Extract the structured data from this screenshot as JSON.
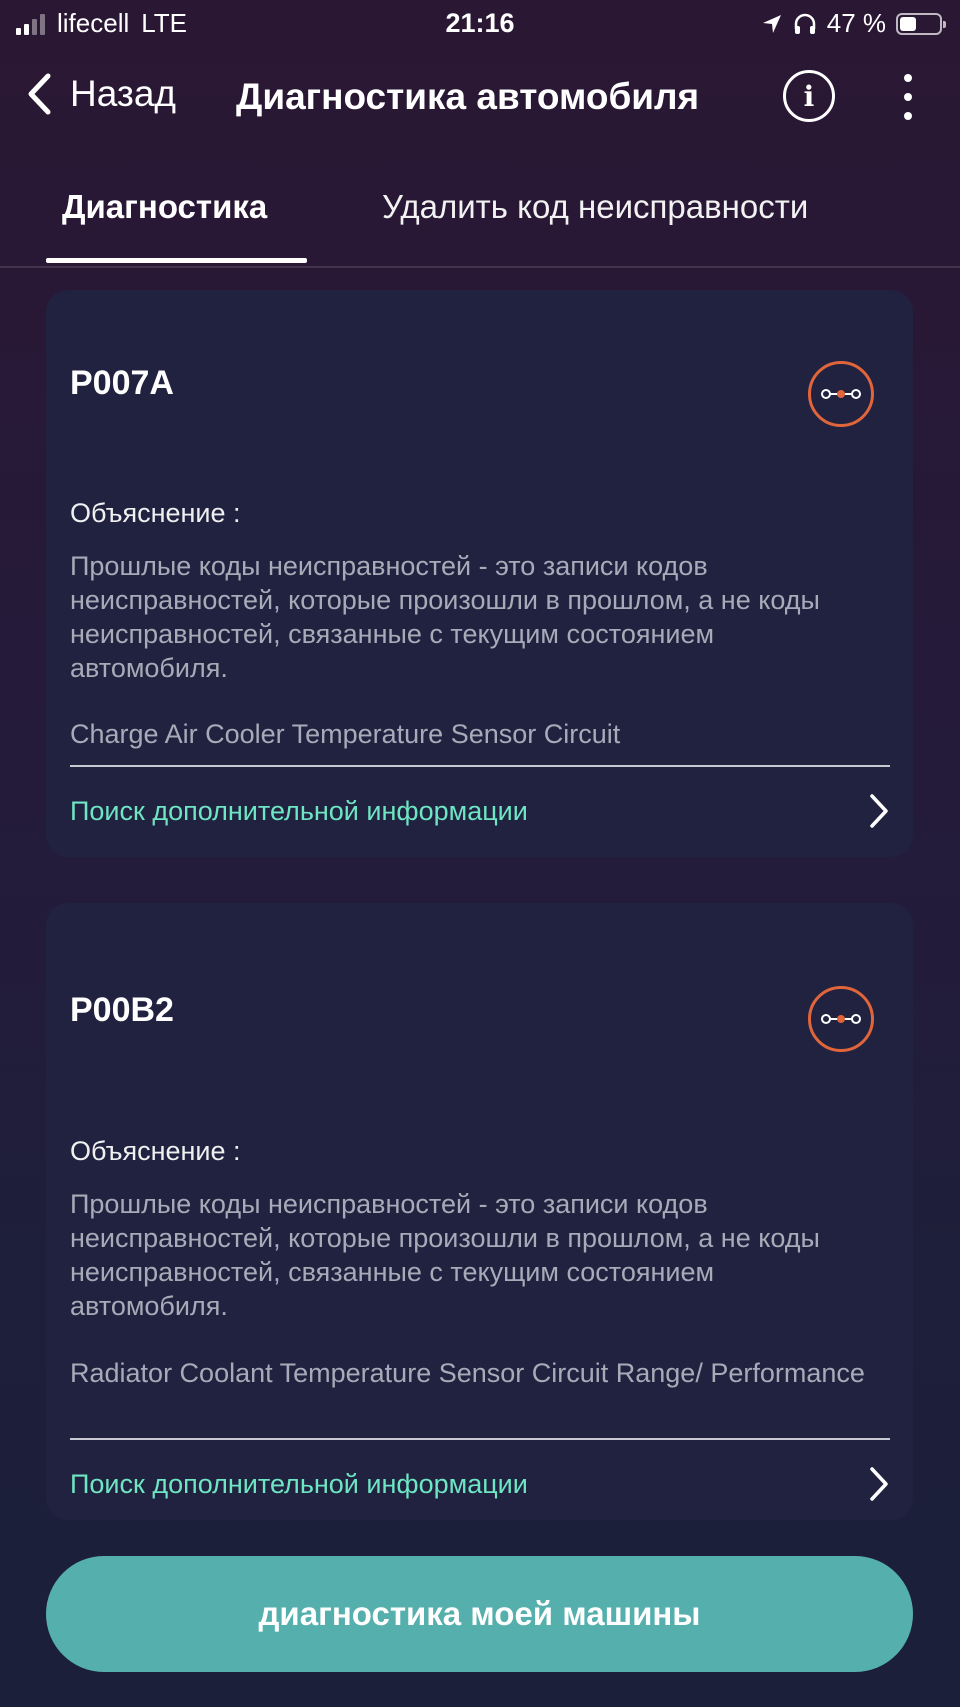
{
  "status_bar": {
    "carrier": "lifecell",
    "network": "LTE",
    "time": "21:16",
    "battery_text": "47 %",
    "battery_level": 0.47
  },
  "nav": {
    "back_label": "Назад",
    "title": "Диагностика автомобиля",
    "info_label": "i"
  },
  "tabs": [
    {
      "label": "Диагностика",
      "active": true
    },
    {
      "label": "Удалить код неисправности",
      "active": false
    }
  ],
  "cards": [
    {
      "code": "P007A",
      "explanation_label": "Объяснение :",
      "explanation": "Прошлые коды неисправностей - это записи кодов неисправностей, которые произошли в прошлом, а не коды неисправностей, связанные с текущим состоянием автомобиля.",
      "description": "Charge Air Cooler Temperature Sensor Circuit",
      "more_info": "Поиск дополнительной информации"
    },
    {
      "code": "P00B2",
      "explanation_label": "Объяснение :",
      "explanation": "Прошлые коды неисправностей - это записи кодов неисправностей, которые произошли в прошлом, а не коды неисправностей, связанные с текущим состоянием автомобиля.",
      "description": "Radiator Coolant Temperature Sensor Circuit Range/ Performance",
      "more_info": "Поиск дополнительной информации"
    }
  ],
  "main_button": "диагностика моей машины",
  "colors": {
    "accent_green": "#6ee5c3",
    "icon_orange": "#e0653a",
    "button_teal": "#55b0ad",
    "card_bg": "#202240"
  }
}
